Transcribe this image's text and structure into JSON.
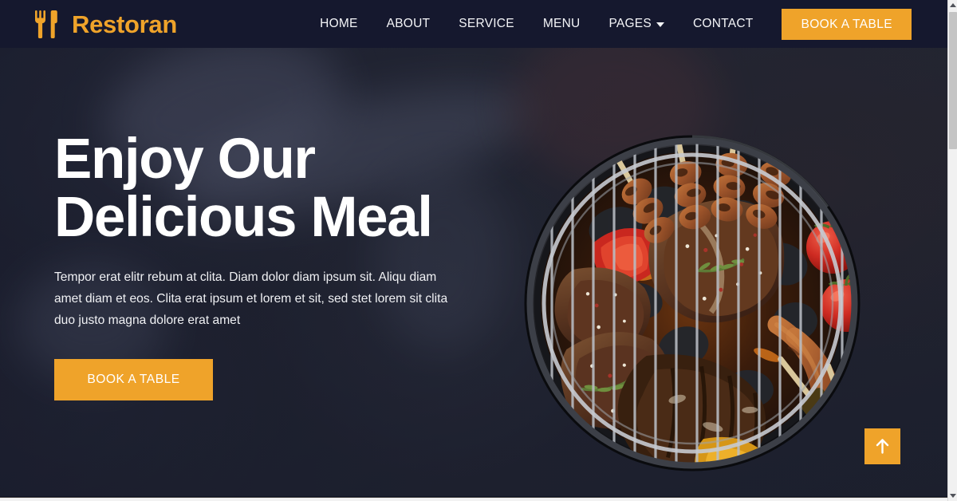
{
  "brand": {
    "name": "Restoran",
    "icon": "fork-knife-icon",
    "color": "#EFA32A"
  },
  "nav": {
    "items": [
      {
        "label": "HOME",
        "has_dropdown": false
      },
      {
        "label": "ABOUT",
        "has_dropdown": false
      },
      {
        "label": "SERVICE",
        "has_dropdown": false
      },
      {
        "label": "MENU",
        "has_dropdown": false
      },
      {
        "label": "PAGES",
        "has_dropdown": true
      },
      {
        "label": "CONTACT",
        "has_dropdown": false
      }
    ],
    "cta_label": "BOOK A TABLE",
    "background": "#15182E"
  },
  "hero": {
    "title_line1": "Enjoy Our",
    "title_line2": "Delicious Meal",
    "paragraph": "Tempor erat elitr rebum at clita. Diam dolor diam ipsum sit. Aliqu diam amet diam et eos. Clita erat ipsum et lorem et sit, sed stet lorem sit clita duo justo magna dolore erat amet",
    "cta_label": "BOOK A TABLE",
    "image_alt": "round-charcoal-grill-with-steaks-sausages-skewers-tomatoes-and-peppers",
    "accent_color": "#EFA32A",
    "background_color": "#282B38"
  },
  "back_to_top": {
    "icon": "arrow-up-icon",
    "color": "#EFA32A"
  },
  "scrollbar": {
    "up_icon": "scroll-up-arrow-icon",
    "down_icon": "scroll-down-arrow-icon",
    "thumb_position_percent": 3,
    "thumb_size_percent": 28
  }
}
